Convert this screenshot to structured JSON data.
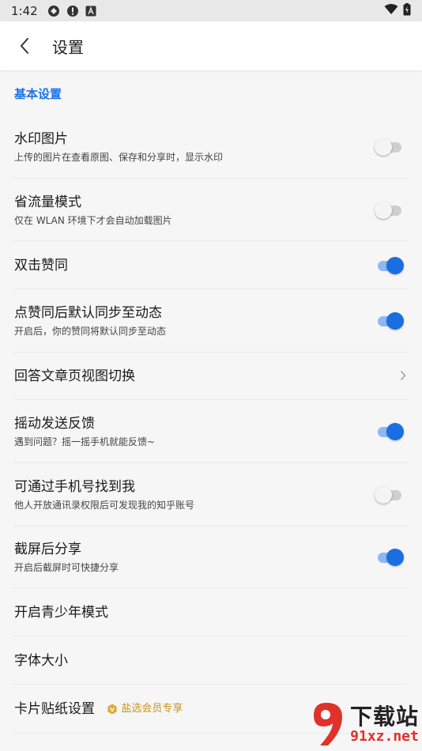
{
  "status_bar": {
    "time": "1:42"
  },
  "app_bar": {
    "title": "设置"
  },
  "section": {
    "header": "基本设置"
  },
  "settings": [
    {
      "title": "水印图片",
      "subtitle": "上传的图片在查看原图、保存和分享时，显示水印",
      "control": "toggle",
      "on": false
    },
    {
      "title": "省流量模式",
      "subtitle": "仅在 WLAN 环境下才会自动加载图片",
      "control": "toggle",
      "on": false
    },
    {
      "title": "双击赞同",
      "subtitle": "",
      "control": "toggle",
      "on": true
    },
    {
      "title": "点赞同后默认同步至动态",
      "subtitle": "开启后，你的赞同将默认同步至动态",
      "control": "toggle",
      "on": true
    },
    {
      "title": "回答文章页视图切换",
      "subtitle": "",
      "control": "chevron"
    },
    {
      "title": "摇动发送反馈",
      "subtitle": "遇到问题？摇一摇手机就能反馈~",
      "control": "toggle",
      "on": true
    },
    {
      "title": "可通过手机号找到我",
      "subtitle": "他人开放通讯录权限后可发现我的知乎账号",
      "control": "toggle",
      "on": false
    },
    {
      "title": "截屏后分享",
      "subtitle": "开启后截屏时可快捷分享",
      "control": "toggle",
      "on": true
    },
    {
      "title": "开启青少年模式",
      "subtitle": "",
      "control": "none"
    },
    {
      "title": "字体大小",
      "subtitle": "",
      "control": "none"
    },
    {
      "title": "卡片贴纸设置",
      "subtitle": "",
      "control": "none",
      "badge": "盐选会员专享"
    }
  ],
  "colors": {
    "accent": "#1a73e8",
    "toggle_on": "#1a6fe0",
    "badge": "#c9941f"
  },
  "watermark": {
    "top": "下载站",
    "bottom": "91xz.net"
  }
}
